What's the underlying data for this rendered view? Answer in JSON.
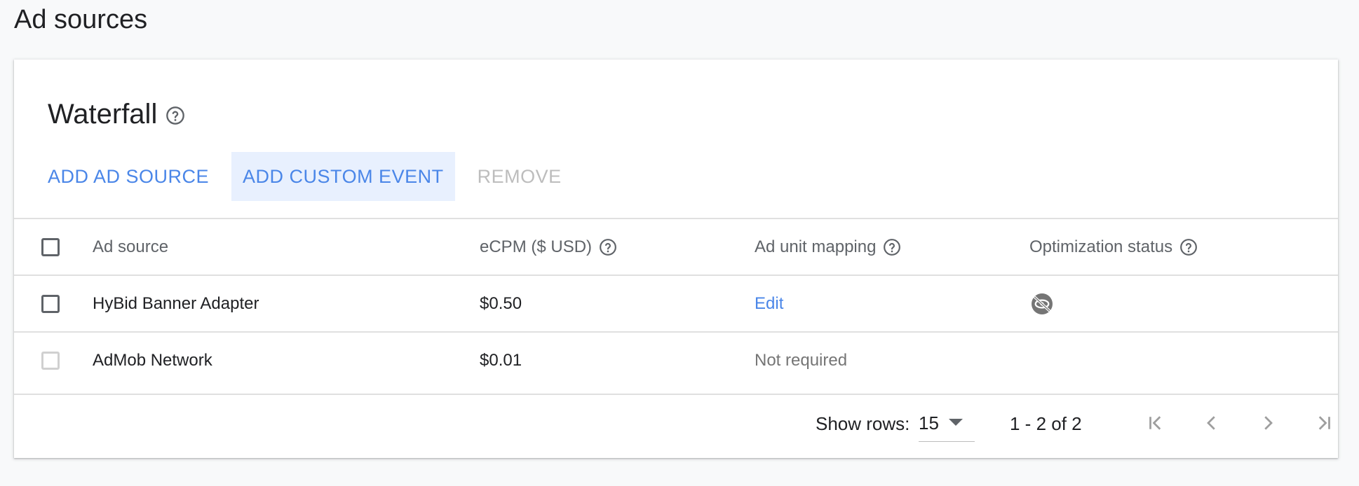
{
  "page": {
    "title": "Ad sources"
  },
  "waterfall": {
    "title": "Waterfall",
    "toolbar": {
      "add_ad_source": "ADD AD SOURCE",
      "add_custom_event": "ADD CUSTOM EVENT",
      "remove": "REMOVE"
    },
    "table": {
      "headers": {
        "ad_source": "Ad source",
        "ecpm": "eCPM ($ USD)",
        "ad_unit_mapping": "Ad unit mapping",
        "optimization_status": "Optimization status"
      },
      "rows": [
        {
          "ad_source": "HyBid Banner Adapter",
          "ecpm": "$0.50",
          "mapping": "Edit",
          "optimization_icon": "optimization-off-icon"
        },
        {
          "ad_source": "AdMob Network",
          "ecpm": "$0.01",
          "mapping": "Not required"
        }
      ]
    },
    "pagination": {
      "show_rows_label": "Show rows:",
      "rows_per_page": "15",
      "range": "1 - 2 of 2"
    }
  },
  "colors": {
    "accent": "#4a86e8",
    "accent_bg": "#e8f0fe",
    "disabled": "#bdbdbd",
    "background": "#f8f9fa"
  }
}
